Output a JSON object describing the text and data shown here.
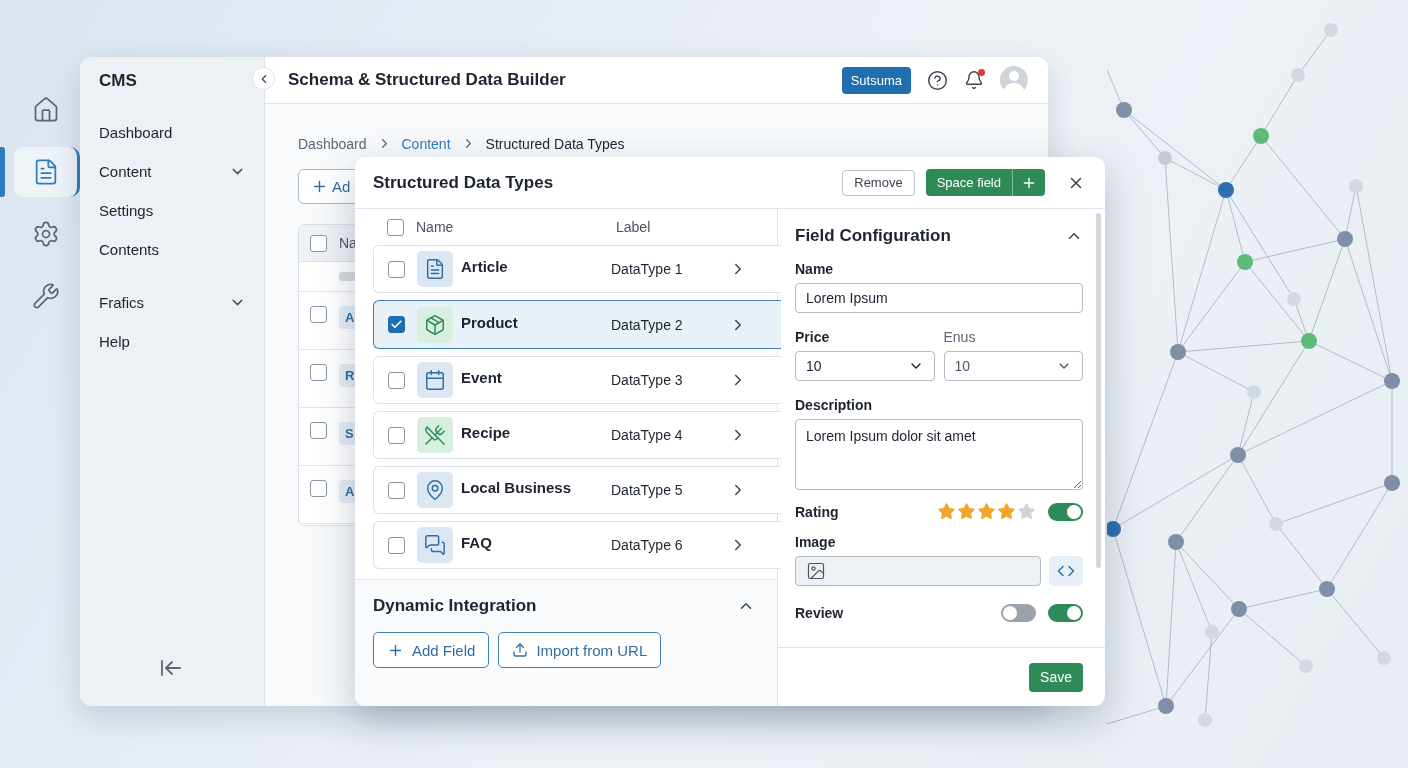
{
  "rail": [
    {
      "kind": "home",
      "selected": false
    },
    {
      "kind": "document",
      "selected": true
    },
    {
      "kind": "gear",
      "selected": false
    },
    {
      "kind": "wrench",
      "selected": false
    }
  ],
  "sidebar": {
    "title": "CMS",
    "groups": [
      [
        {
          "label": "Dashboard",
          "expandable": false
        },
        {
          "label": "Content",
          "expandable": true
        },
        {
          "label": "Settings",
          "expandable": false
        },
        {
          "label": "Contents",
          "expandable": false
        }
      ],
      [
        {
          "label": "Frafics",
          "expandable": true
        },
        {
          "label": "Help",
          "expandable": false
        }
      ]
    ]
  },
  "header": {
    "title": "Schema & Structured Data Builder",
    "workspace": "Sutsuma",
    "notification": true
  },
  "breadcrumb": [
    {
      "label": "Dashboard",
      "link": false
    },
    {
      "label": "Content",
      "link": true
    },
    {
      "label": "Structured Data Types",
      "link": false
    }
  ],
  "background_table": {
    "add_button": "Ad",
    "column": "Na",
    "all_checked": false,
    "rows": [
      {
        "text": "A",
        "checked": false
      },
      {
        "text": "R",
        "checked": false
      },
      {
        "text": "S",
        "checked": false
      },
      {
        "text": "A",
        "checked": false
      }
    ]
  },
  "modal": {
    "title": "Structured Data Types",
    "remove": "Remove",
    "primary": "Space field",
    "columns": [
      "Name",
      "Label"
    ],
    "all_checked": false,
    "rows": [
      {
        "kind": "article",
        "name": "Article",
        "label": "DataType 1",
        "checked": false,
        "selected": false
      },
      {
        "kind": "product",
        "name": "Product",
        "label": "DataType 2",
        "checked": true,
        "selected": true
      },
      {
        "kind": "event",
        "name": "Event",
        "label": "DataType 3",
        "checked": false,
        "selected": false
      },
      {
        "kind": "recipe",
        "name": "Recipe",
        "label": "DataType 4",
        "checked": false,
        "selected": false
      },
      {
        "kind": "place",
        "name": "Local Business",
        "label": "DataType 5",
        "checked": false,
        "selected": false
      },
      {
        "kind": "faq",
        "name": "FAQ",
        "label": "DataType 6",
        "checked": false,
        "selected": false
      }
    ],
    "integration": {
      "title": "Dynamic Integration",
      "expanded": true,
      "buttons": [
        {
          "kind": "add",
          "label": "Add Field"
        },
        {
          "kind": "upload",
          "label": "Import from URL"
        }
      ]
    },
    "config": {
      "title": "Field Configuration",
      "expanded": true,
      "name": {
        "label": "Name",
        "value": "Lorem Ipsum"
      },
      "price": {
        "label": "Price",
        "value": "10",
        "disabled": false
      },
      "enus": {
        "label": "Enus",
        "value": "10",
        "disabled": true
      },
      "description": {
        "label": "Description",
        "value": "Lorem Ipsum dolor sit amet"
      },
      "rating": {
        "label": "Rating",
        "stars": 4,
        "on": true
      },
      "image": {
        "label": "Image"
      },
      "review": {
        "label": "Review",
        "toggles": [
          {
            "on": false
          },
          {
            "on": true
          }
        ]
      },
      "save": "Save"
    }
  }
}
